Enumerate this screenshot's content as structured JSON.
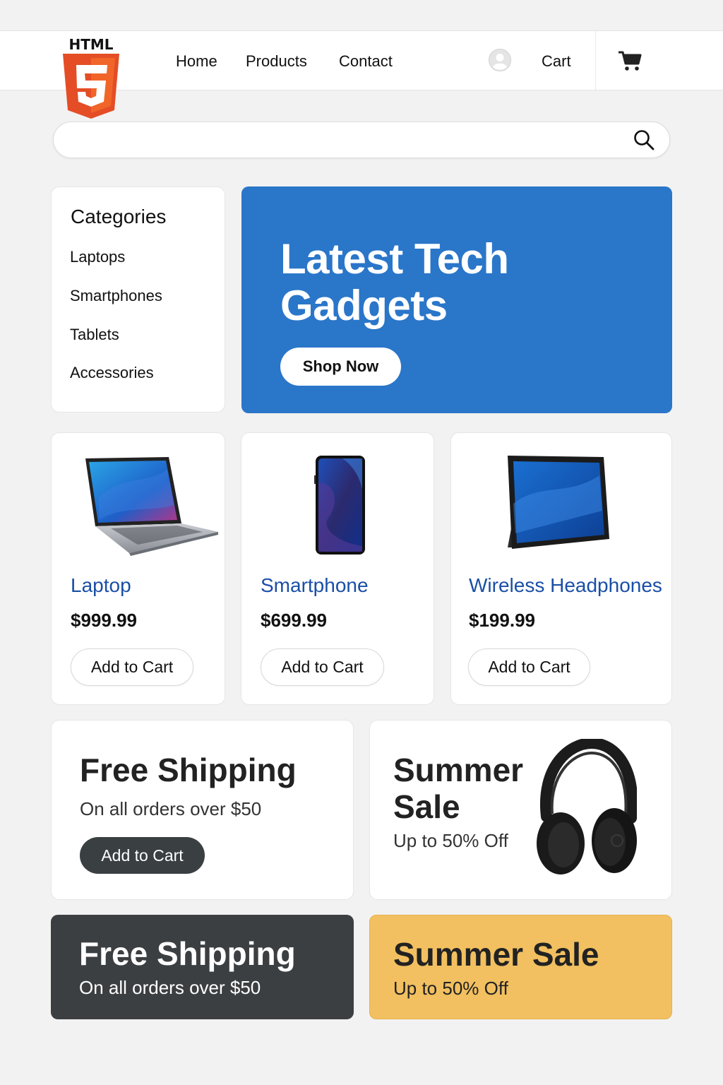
{
  "logo": {
    "text": "HTML",
    "badge": "5",
    "icon": "html5-logo-icon",
    "color": "#e44d26"
  },
  "nav": {
    "links": [
      "Home",
      "Products",
      "Contact"
    ],
    "user_icon": "user-avatar-icon",
    "cart_label": "Cart",
    "cart_icon": "shopping-cart-icon"
  },
  "search": {
    "placeholder": "",
    "value": "",
    "icon": "search-icon"
  },
  "categories": {
    "title": "Categories",
    "items": [
      "Laptops",
      "Smartphones",
      "Tablets",
      "Accessories"
    ]
  },
  "hero": {
    "title": "Latest Tech Gadgets",
    "button": "Shop Now",
    "color": "#2a76c9"
  },
  "products": [
    {
      "name": "Laptop",
      "price": "$999.99",
      "button": "Add to Cart",
      "image": "laptop-image"
    },
    {
      "name": "Smartphone",
      "price": "$699.99",
      "button": "Add to Cart",
      "image": "smartphone-image"
    },
    {
      "name": "Wireless Headphones",
      "price": "$199.99",
      "button": "Add to Cart",
      "image": "tablet-image"
    }
  ],
  "promos": [
    {
      "title": "Free Shipping",
      "subtitle": "On all orders over $50",
      "button": "Add to Cart"
    },
    {
      "title": "Summer Sale",
      "subtitle": "Up to 50% Off",
      "image": "headphones-image"
    }
  ],
  "banners": [
    {
      "title": "Free Shipping",
      "subtitle": "On all orders over $50",
      "color": "#3c3f42"
    },
    {
      "title": "Summer Sale",
      "subtitle": "Up to 50% Off",
      "color": "#f2c060"
    }
  ]
}
